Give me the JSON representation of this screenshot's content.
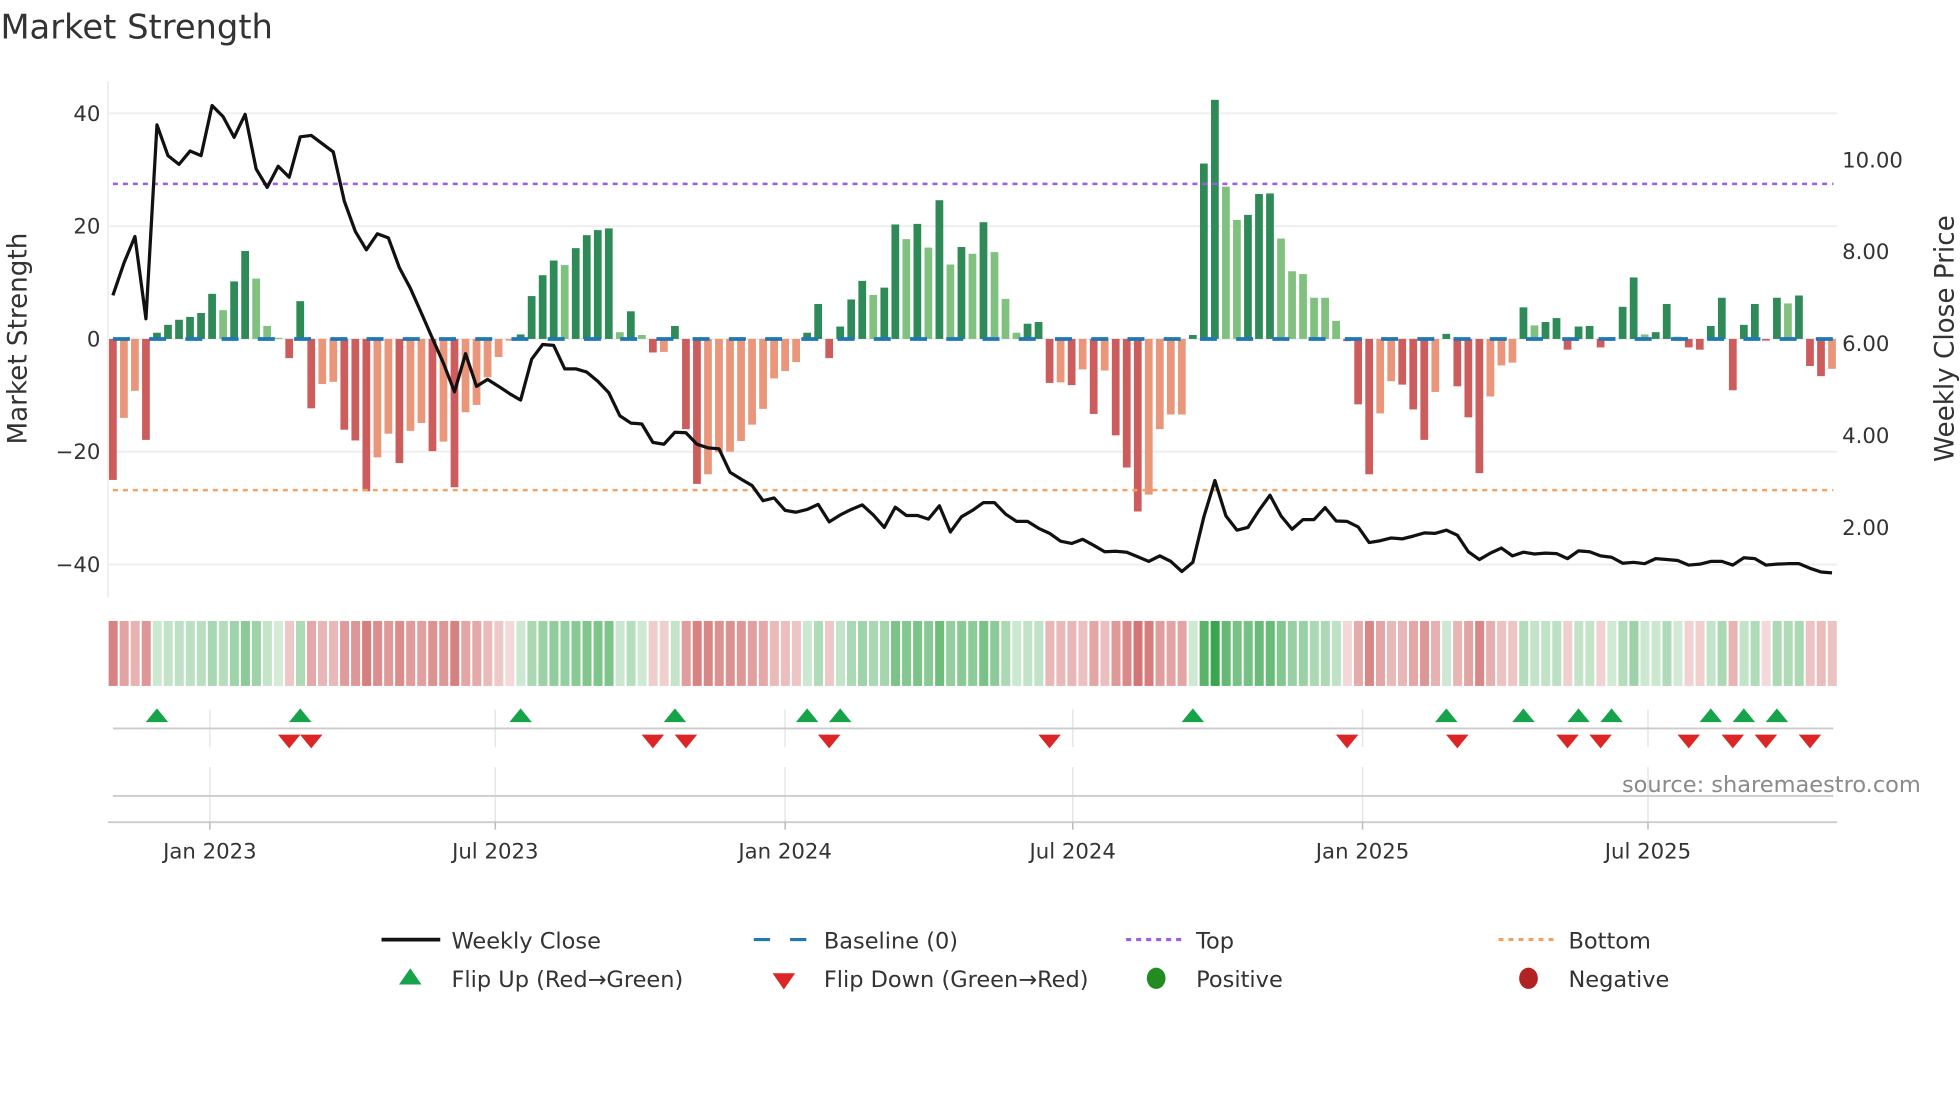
{
  "title": "Market Strength",
  "source": "source: sharemaestro.com",
  "colors": {
    "strong_green": "#2e8b57",
    "weak_green": "#81c17f",
    "strong_red": "#cd5c5c",
    "weak_red": "#e9967a",
    "baseline": "#1f77b4",
    "top": "#9b5de5",
    "bottom": "#f4a261",
    "price": "#111111",
    "flip_up": "#17a34a",
    "flip_down": "#dc2626",
    "positive": "#228b22",
    "negative": "#b22222"
  },
  "legend": [
    {
      "key": "weekly_close",
      "label": "Weekly Close"
    },
    {
      "key": "baseline",
      "label": "Baseline (0)"
    },
    {
      "key": "top",
      "label": "Top"
    },
    {
      "key": "bottom",
      "label": "Bottom"
    },
    {
      "key": "flip_up",
      "label": "Flip Up (Red→Green)"
    },
    {
      "key": "flip_down",
      "label": "Flip Down (Green→Red)"
    },
    {
      "key": "positive",
      "label": "Positive"
    },
    {
      "key": "negative",
      "label": "Negative"
    }
  ],
  "chart_data": {
    "type": "bar",
    "title": "Market Strength",
    "ylabel": "Market Strength",
    "y2label": "Weekly Close Price",
    "ylim": [
      -45.8,
      45.7
    ],
    "y2lim": [
      0.48,
      11.71
    ],
    "yticks": [
      {
        "v": 40,
        "label": "40"
      },
      {
        "v": 20,
        "label": "20"
      },
      {
        "v": 0,
        "label": "0"
      },
      {
        "v": -20,
        "label": "−20"
      },
      {
        "v": -40,
        "label": "−40"
      }
    ],
    "y2ticks": [
      {
        "v": 10,
        "label": "10.00"
      },
      {
        "v": 8,
        "label": "8.00"
      },
      {
        "v": 6,
        "label": "6.00"
      },
      {
        "v": 4,
        "label": "4.00"
      },
      {
        "v": 2,
        "label": "2.00"
      }
    ],
    "xticks": [
      {
        "week": 8.8,
        "label": "Jan 2023"
      },
      {
        "week": 34.7,
        "label": "Jul 2023"
      },
      {
        "week": 61.0,
        "label": "Jan 2024"
      },
      {
        "week": 87.1,
        "label": "Jul 2024"
      },
      {
        "week": 113.4,
        "label": "Jan 2025"
      },
      {
        "week": 139.3,
        "label": "Jul 2025"
      }
    ],
    "top_level": 27.5,
    "bottom_level": -26.8,
    "baseline": 0,
    "strength": [
      -25,
      -14,
      -9.2,
      -17.9,
      1.1,
      2.5,
      3.4,
      3.9,
      4.6,
      8.0,
      5.1,
      10.2,
      15.6,
      10.7,
      2.3,
      0.2,
      -3.4,
      6.7,
      -12.3,
      -8,
      -7.6,
      -16.1,
      -18,
      -27,
      -21,
      -16.8,
      -22,
      -16.3,
      -14.9,
      -19.9,
      -18.2,
      -26.3,
      -13,
      -11.7,
      -6.8,
      -3.2,
      -0.3,
      0.8,
      7.6,
      11.3,
      13.9,
      13.1,
      16.1,
      18.4,
      19.3,
      19.6,
      1.2,
      4.9,
      0.7,
      -2.4,
      -2.3,
      2.3,
      -16,
      -25.7,
      -24,
      -20.1,
      -20,
      -18.1,
      -15.2,
      -12.4,
      -7,
      -5.7,
      -4.1,
      1.1,
      6.2,
      -3.4,
      2.2,
      7.0,
      10.3,
      7.8,
      9.1,
      20.3,
      17.7,
      20.4,
      16.2,
      24.6,
      13.2,
      16.3,
      15.1,
      20.7,
      15.4,
      7.1,
      1.1,
      2.7,
      3.0,
      -7.8,
      -7.7,
      -8.2,
      -5.4,
      -13.3,
      -5.6,
      -17.1,
      -22.8,
      -30.6,
      -27.6,
      -16,
      -13.4,
      -13.4,
      0.7,
      31.1,
      42.4,
      27,
      21.1,
      22,
      25.7,
      25.8,
      17.8,
      12,
      11.5,
      7.3,
      7.3,
      3.2,
      -0.4,
      -11.6,
      -24,
      -13.2,
      -7.5,
      -8.1,
      -12.5,
      -17.9,
      -9.4,
      0.9,
      -8.4,
      -13.9,
      -23.8,
      -10.2,
      -4.7,
      -4.2,
      5.6,
      2.4,
      3.0,
      3.7,
      -1.9,
      2.2,
      2.3,
      -1.5,
      0.3,
      5.7,
      10.9,
      0.8,
      1.2,
      6.2,
      0.4,
      -1.5,
      -1.9,
      2.3,
      7.3,
      -9.1,
      2.5,
      6.2,
      -0.3,
      7.3,
      6.3,
      7.7,
      -4.8,
      -6.6,
      -5.3
    ],
    "weekly_close": [
      7.05,
      7.75,
      8.33,
      6.54,
      10.76,
      10.09,
      9.9,
      10.19,
      10.09,
      11.18,
      10.94,
      10.49,
      10.99,
      9.8,
      9.4,
      9.86,
      9.62,
      10.5,
      10.53,
      10.35,
      10.17,
      9.1,
      8.44,
      8.04,
      8.39,
      8.3,
      7.65,
      7.2,
      6.66,
      6.11,
      5.57,
      4.95,
      5.78,
      5.07,
      5.22,
      5.07,
      4.91,
      4.77,
      5.66,
      5.98,
      5.96,
      5.45,
      5.45,
      5.38,
      5.18,
      4.93,
      4.43,
      4.27,
      4.25,
      3.85,
      3.81,
      4.07,
      4.06,
      3.81,
      3.73,
      3.71,
      3.2,
      3.05,
      2.91,
      2.58,
      2.64,
      2.37,
      2.33,
      2.39,
      2.5,
      2.12,
      2.27,
      2.39,
      2.49,
      2.27,
      2.0,
      2.44,
      2.26,
      2.26,
      2.18,
      2.47,
      1.9,
      2.23,
      2.37,
      2.54,
      2.54,
      2.29,
      2.13,
      2.13,
      1.98,
      1.87,
      1.7,
      1.65,
      1.74,
      1.61,
      1.47,
      1.48,
      1.46,
      1.36,
      1.26,
      1.38,
      1.26,
      1.04,
      1.24,
      2.23,
      3.02,
      2.25,
      1.94,
      2.0,
      2.37,
      2.7,
      2.25,
      1.96,
      2.17,
      2.17,
      2.43,
      2.14,
      2.13,
      2.01,
      1.67,
      1.71,
      1.77,
      1.75,
      1.81,
      1.88,
      1.87,
      1.94,
      1.83,
      1.47,
      1.3,
      1.44,
      1.55,
      1.38,
      1.46,
      1.42,
      1.44,
      1.43,
      1.32,
      1.49,
      1.47,
      1.38,
      1.35,
      1.22,
      1.24,
      1.21,
      1.32,
      1.3,
      1.28,
      1.18,
      1.2,
      1.26,
      1.26,
      1.18,
      1.34,
      1.32,
      1.18,
      1.2,
      1.21,
      1.21,
      1.11,
      1.03,
      1.01
    ],
    "flip_up_weeks": [
      4,
      17,
      37,
      51,
      63,
      66,
      98,
      121,
      128,
      133,
      136,
      145,
      148,
      151
    ],
    "flip_down_weeks": [
      16,
      18,
      49,
      52,
      65,
      85,
      112,
      122,
      132,
      135,
      143,
      147,
      150,
      154
    ],
    "grid": true,
    "legend_position": "bottom"
  }
}
